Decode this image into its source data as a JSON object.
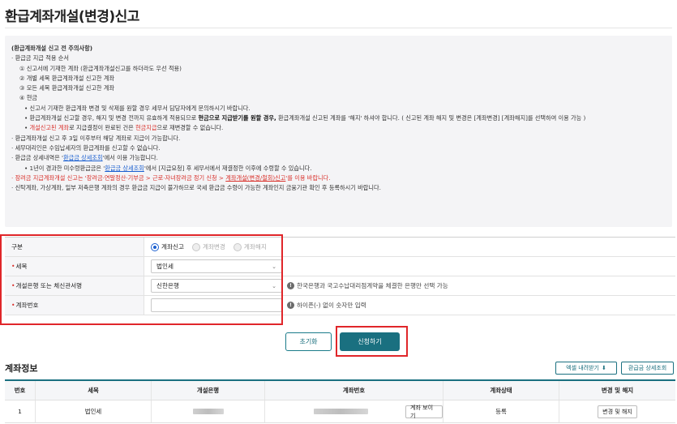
{
  "page": {
    "title": "환급계좌개설(변경)신고"
  },
  "notice": {
    "heading": "(환급계좌개설 신고 전 주의사항)",
    "l1": "· 환급금 지급 적용 순서",
    "l2": "① 신고서에 기재한 계좌 (환급계좌개설신고를 하더라도 우선 적용)",
    "l3": "② 개별 세목 환급계좌개설 신고한 계좌",
    "l4": "③ 모든 세목 환급계좌개설 신고한 계좌",
    "l5": "④ 현금",
    "l6": "• 신고서 기재한 환급계좌 변경 및 삭제를 원할 경우 세무서 담당자에게 문의하시기 바랍니다.",
    "l7a": "• 환급계좌개설 신고할 경우, 해지 및 변경 전까지 유효하게 적용되므로 ",
    "l7b": "현금으로 지급받기를 원할 경우,",
    "l7c": " 환급계좌개설 신고된 계좌를 '해지' 하셔야 합니다. ( 신고된 계좌 해지 및 변경은 [계좌변경] [계좌해지]를 선택하여 이용 가능 )",
    "l8a": "• ",
    "l8b": "개설신고된 계좌",
    "l8c": "로 지급결정이 완료된 건은 ",
    "l8d": "현금지급",
    "l8e": "으로 재변경할 수 없습니다.",
    "l9": "· 환급계좌개설 신고 후 3일 이후부터 해당 계좌로 지급이 가능합니다.",
    "l10": "· 세무대리인은 수임납세자의 환급계좌를 신고할 수 없습니다.",
    "l11a": "· 환급금 상세내역은 '",
    "l11b": "환급금 상세조회",
    "l11c": "'에서 이용 가능합니다.",
    "l12a": "• 1년이 경과한 미수령환급금은 '",
    "l12b": "환급금 상세조회",
    "l12c": "'에서 [지급요청] 후 세무서에서 재결정한 이후에 수령할 수 있습니다.",
    "l13a": "· 장려금 지급계좌개설 신고는 '장려금·연말정산·기부금 > 근로·자녀장려금 정기 신청 > ",
    "l13b": "계좌개설(변경/철회)신고",
    "l13c": "'를 이용 바랍니다.",
    "l14": "· 신탁계좌, 가상계좌, 일부 저축은행 계좌의 경우 환급금 지급이 불가하므로 국세 환급금 수령이 가능한 계좌인지 금융기관 확인 후 등록하시기 바랍니다."
  },
  "form": {
    "type_label": "구분",
    "type_options": [
      "계좌신고",
      "계좌변경",
      "계좌해지"
    ],
    "tax_label": "세목",
    "tax_value": "법인세",
    "bank_label": "개설은행 또는 체신관서명",
    "bank_value": "신한은행",
    "bank_hint": "한국은행과 국고수납대리점계약을 체결한 은행만 선택 가능",
    "account_label": "계좌번호",
    "account_value": "",
    "account_hint": "하이픈(-) 없이 숫자만 입력",
    "reset_label": "초기화",
    "apply_label": "신청하기"
  },
  "accounts": {
    "title": "계좌정보",
    "excel_label": "엑셀 내려받기",
    "refund_detail_label": "환급금 상세조회",
    "columns": [
      "번호",
      "세목",
      "개설은행",
      "계좌번호",
      "계좌상태",
      "변경 및 해지"
    ],
    "rows": [
      {
        "no": "1",
        "tax": "법인세",
        "status": "등록",
        "view_label": "계좌 보이기",
        "change_label": "변경 및 해지"
      }
    ]
  },
  "colors": {
    "accent": "#1a7080",
    "highlight": "#e0262a",
    "warn": "#d9302a",
    "link": "#1a5fd0"
  }
}
